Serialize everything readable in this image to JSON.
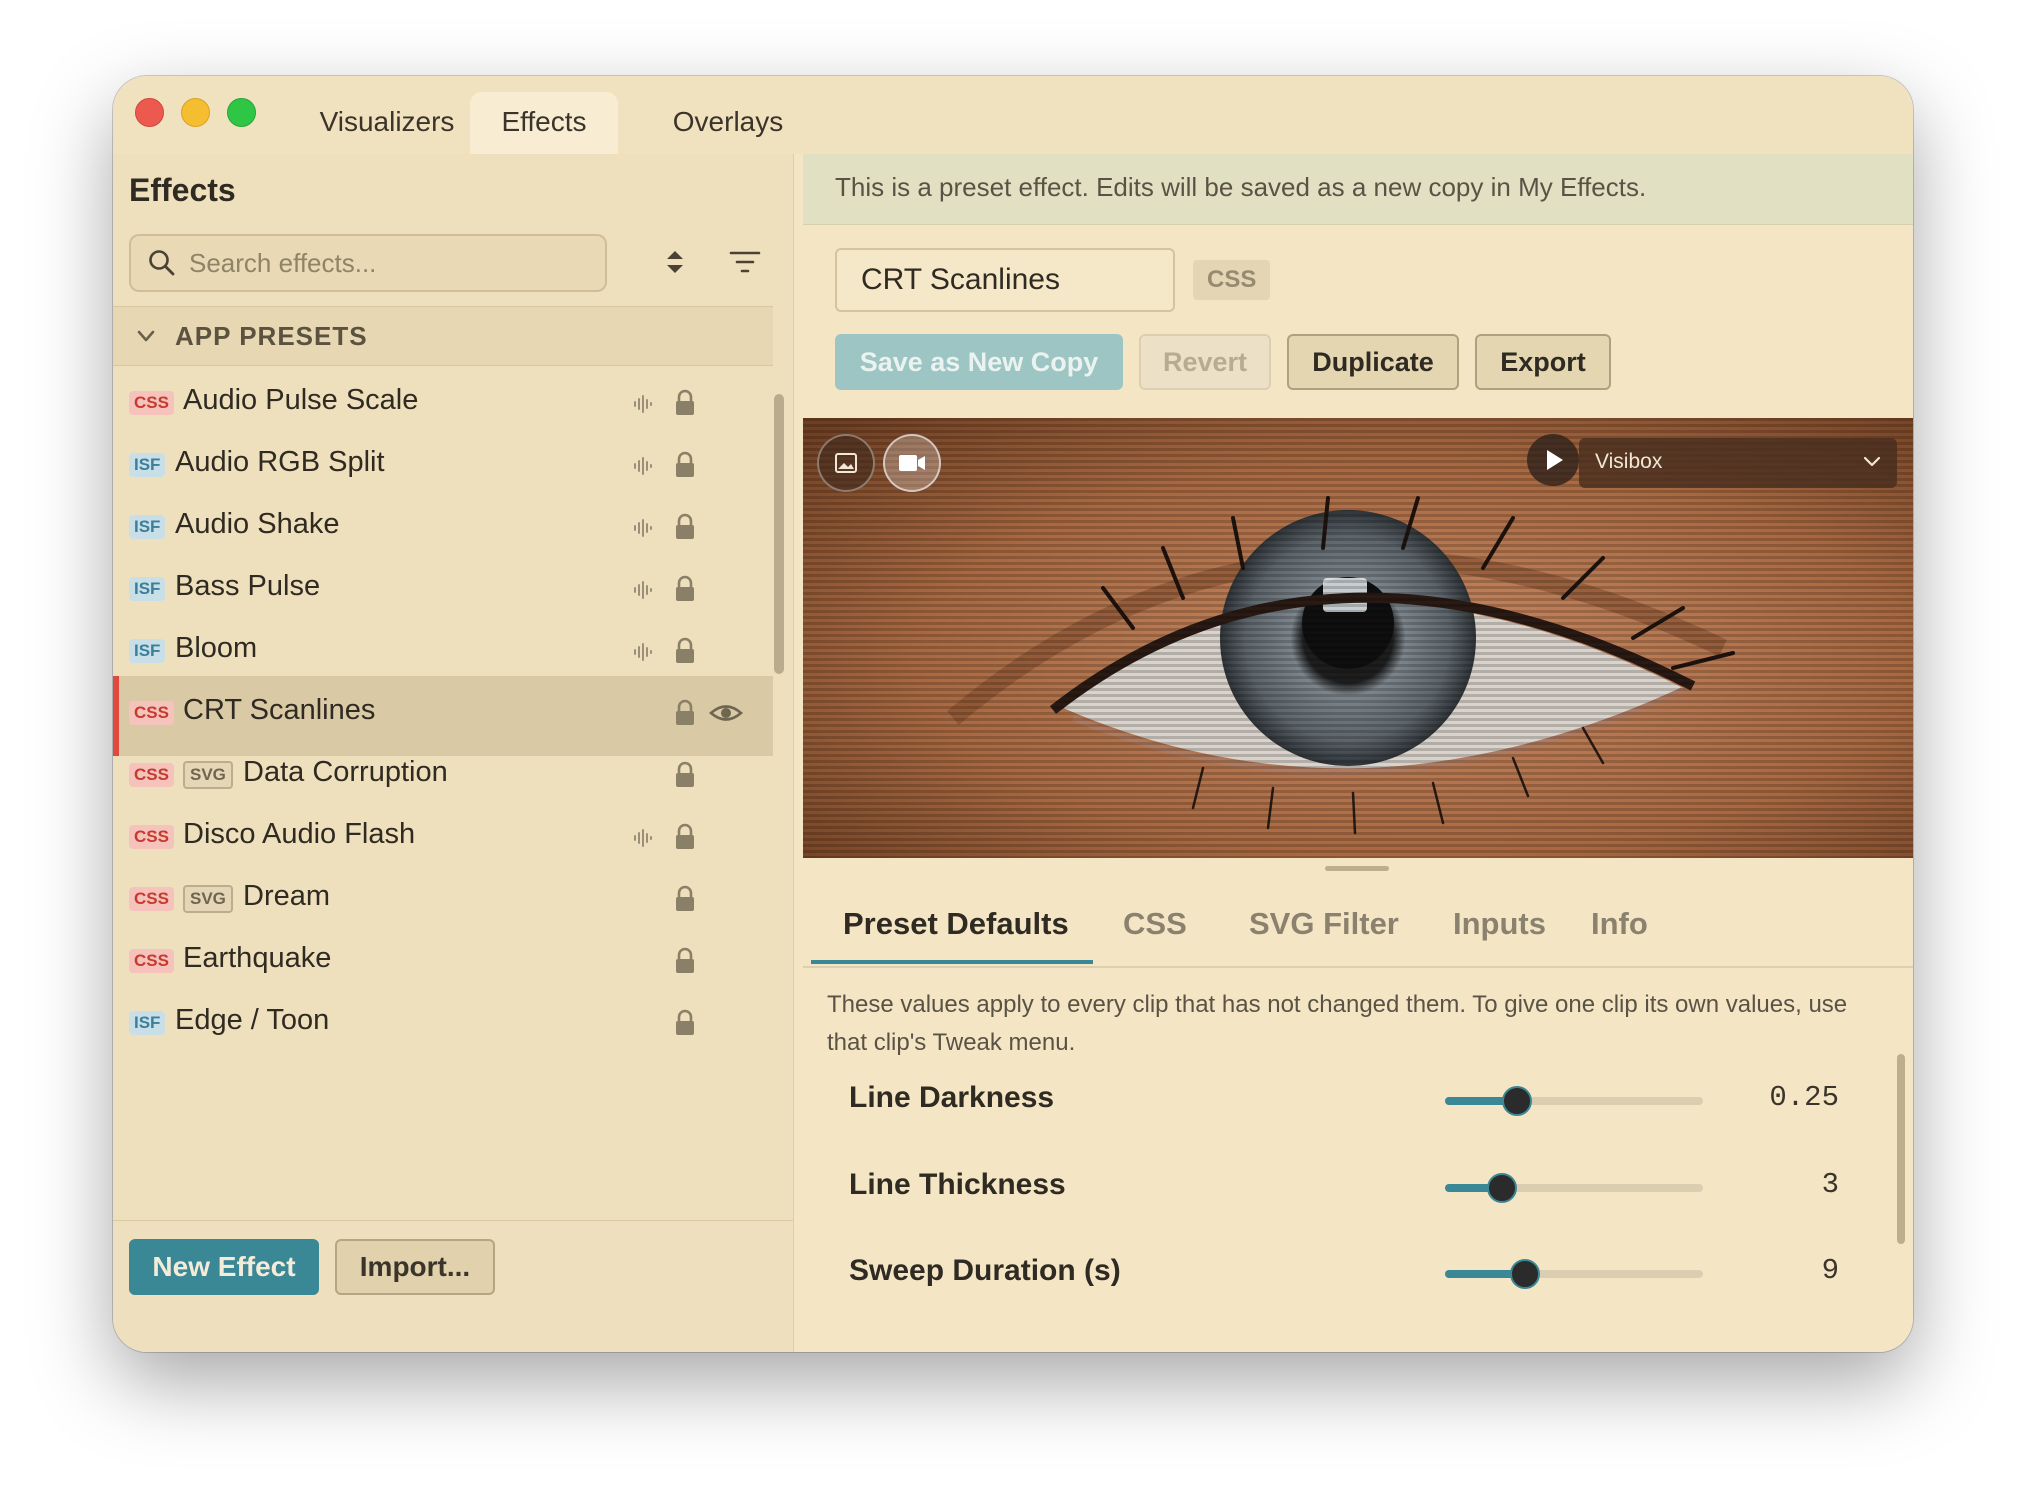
{
  "window": {
    "tabs": [
      "Visualizers",
      "Effects",
      "Overlays"
    ],
    "active_tab": "Effects"
  },
  "sidebar": {
    "title": "Effects",
    "search_placeholder": "Search effects...",
    "group_label": "APP PRESETS",
    "items": [
      {
        "name": "Audio Pulse Scale",
        "tags": [
          "CSS"
        ],
        "audio": true,
        "locked": true,
        "selected": false
      },
      {
        "name": "Audio RGB Split",
        "tags": [
          "ISF"
        ],
        "audio": true,
        "locked": true,
        "selected": false
      },
      {
        "name": "Audio Shake",
        "tags": [
          "ISF"
        ],
        "audio": true,
        "locked": true,
        "selected": false
      },
      {
        "name": "Bass Pulse",
        "tags": [
          "ISF"
        ],
        "audio": true,
        "locked": true,
        "selected": false
      },
      {
        "name": "Bloom",
        "tags": [
          "ISF"
        ],
        "audio": true,
        "locked": true,
        "selected": false
      },
      {
        "name": "CRT Scanlines",
        "tags": [
          "CSS"
        ],
        "audio": false,
        "locked": true,
        "selected": true
      },
      {
        "name": "Data Corruption",
        "tags": [
          "CSS",
          "SVG"
        ],
        "audio": false,
        "locked": true,
        "selected": false
      },
      {
        "name": "Disco Audio Flash",
        "tags": [
          "CSS"
        ],
        "audio": true,
        "locked": true,
        "selected": false
      },
      {
        "name": "Dream",
        "tags": [
          "CSS",
          "SVG"
        ],
        "audio": false,
        "locked": true,
        "selected": false
      },
      {
        "name": "Earthquake",
        "tags": [
          "CSS"
        ],
        "audio": false,
        "locked": true,
        "selected": false
      },
      {
        "name": "Edge / Toon",
        "tags": [
          "ISF"
        ],
        "audio": false,
        "locked": true,
        "selected": false
      }
    ],
    "new_effect_label": "New Effect",
    "import_label": "Import..."
  },
  "main": {
    "notice": "This is a preset effect. Edits will be saved as a new copy in My Effects.",
    "effect_name": "CRT Scanlines",
    "effect_type": "CSS",
    "buttons": {
      "save_copy": "Save as New Copy",
      "revert": "Revert",
      "duplicate": "Duplicate",
      "export": "Export"
    },
    "preview": {
      "source": "Visibox"
    },
    "tabs": [
      "Preset Defaults",
      "CSS",
      "SVG Filter",
      "Inputs",
      "Info"
    ],
    "active_tab": "Preset Defaults",
    "description": "These values apply to every clip that has not changed them. To give one clip its own values, use that clip's Tweak menu.",
    "params": [
      {
        "label": "Line Darkness",
        "value": "0.25",
        "fraction": 0.28
      },
      {
        "label": "Line Thickness",
        "value": "3",
        "fraction": 0.22
      },
      {
        "label": "Sweep Duration (s)",
        "value": "9",
        "fraction": 0.31
      }
    ]
  },
  "colors": {
    "accent": "#3a8796",
    "selected_border": "#e04a3e",
    "css_badge": "#c63b2e",
    "isf_badge": "#3b7f9a"
  }
}
